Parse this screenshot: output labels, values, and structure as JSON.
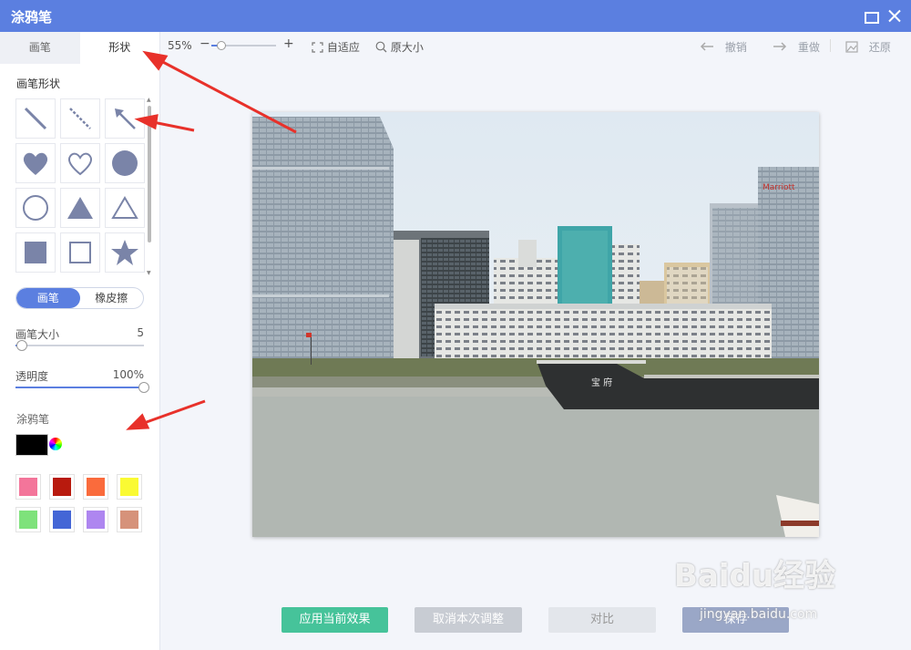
{
  "window": {
    "title": "涂鸦笔"
  },
  "sidebar": {
    "tabs": [
      {
        "label": "画笔"
      },
      {
        "label": "形状"
      }
    ],
    "shape_section_label": "画笔形状",
    "shapes": [
      "line-icon",
      "dashed-line-icon",
      "arrow-icon",
      "heart-filled-icon",
      "heart-outline-icon",
      "circle-filled-icon",
      "circle-outline-icon",
      "triangle-filled-icon",
      "triangle-outline-icon",
      "square-filled-icon",
      "square-outline-icon",
      "star-filled-icon"
    ],
    "mode_toggle": {
      "brush": "画笔",
      "eraser": "橡皮擦",
      "selected": "画笔"
    },
    "brush_size": {
      "label": "画笔大小",
      "value": "5",
      "level": 0.05
    },
    "opacity": {
      "label": "透明度",
      "value": "100%",
      "level": 1.0
    },
    "color_section_label": "涂鸦笔",
    "current_color": "#000000",
    "palette": [
      "#f3759a",
      "#b81a0e",
      "#fa6b3c",
      "#fafa33",
      "#7ee27b",
      "#4466d6",
      "#ae86f0",
      "#d6927a"
    ]
  },
  "toolbar": {
    "zoom": "55%",
    "zoom_minus": "−",
    "zoom_plus": "+",
    "fit": "自适应",
    "original_size": "原大小",
    "undo": "撤销",
    "redo": "重做",
    "restore": "还原"
  },
  "canvas": {
    "ship_name": "宝 府"
  },
  "actions": {
    "apply": "应用当前效果",
    "cancel": "取消本次调整",
    "compare": "对比",
    "save": "保存"
  },
  "watermark": {
    "logo": "Baidu经验",
    "url": "jingyan.baidu.com"
  },
  "colors": {
    "accent": "#5b7fe0",
    "apply": "#46c39a",
    "annotation_arrow": "#e8312a"
  }
}
